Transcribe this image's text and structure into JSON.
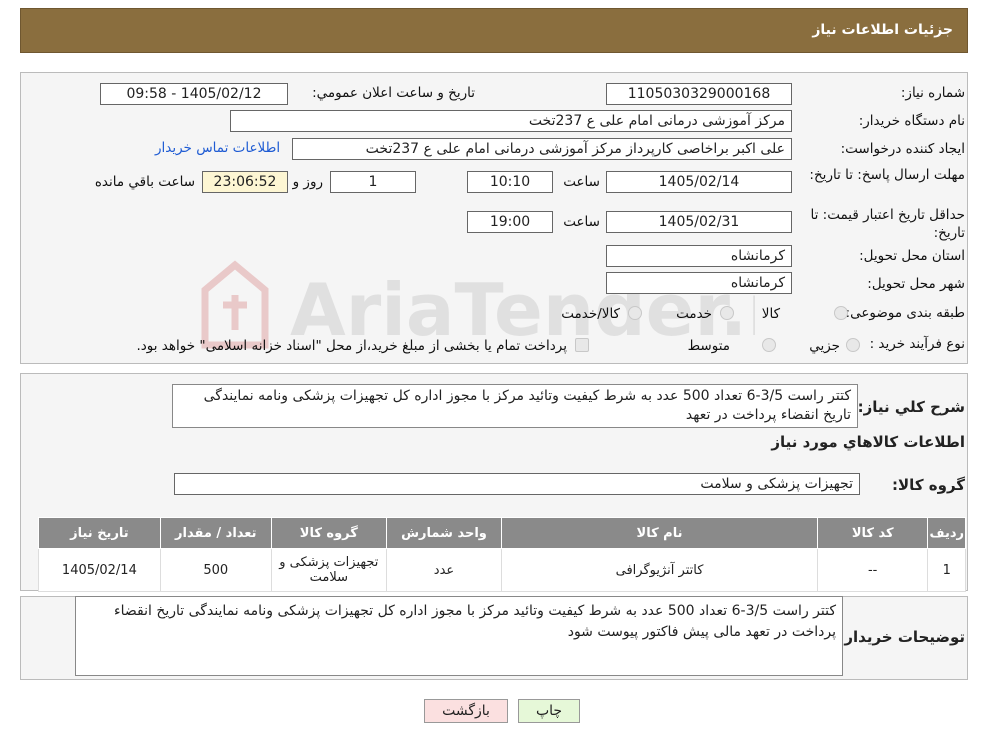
{
  "header": {
    "title": "جزئیات اطلاعات نیاز"
  },
  "watermark": {
    "text": "AriaTender.neT"
  },
  "info": {
    "need_number_label": "شماره نیاز:",
    "need_number": "1105030329000168",
    "announce_label": "تاریخ و ساعت اعلان عمومي:",
    "announce_value": "1405/02/12 - 09:58",
    "buyer_org_label": "نام دستگاه خريدار:",
    "buyer_org": "مرکز آموزشی درمانی امام علی ع 237تخت",
    "creator_label": "ايجاد کننده درخواست:",
    "creator": "علی اکبر براخاصی کارپرداز  مرکز آموزشی درمانی امام علی ع 237تخت",
    "contact_link": "اطلاعات تماس خريدار",
    "reply_deadline_label": "مهلت ارسال پاسخ: تا تاريخ:",
    "reply_date": "1405/02/14",
    "time_label": "ساعت",
    "reply_time": "10:10",
    "days": "1",
    "days_label": "روز و",
    "remaining_time": "23:06:52",
    "remaining_label": "ساعت باقي مانده",
    "price_validity_label": "حداقل تاريخ اعتبار قيمت: تا تاريخ:",
    "price_date": "1405/02/31",
    "price_time": "19:00",
    "province_label": "استان محل تحويل:",
    "province": "کرمانشاه",
    "city_label": "شهر محل تحويل:",
    "city": "کرمانشاه",
    "category_label": "طبقه بندی موضوعی:",
    "category_options": [
      "کالا",
      "خدمت",
      "کالا/خدمت"
    ],
    "purchase_type_label": "نوع فرآيند خريد :",
    "purchase_options": [
      "جزيي",
      "متوسط"
    ],
    "purchase_note": "پرداخت تمام يا بخشی از مبلغ خريد،از محل \"اسناد خزانه اسلامی\" خواهد بود."
  },
  "description": {
    "label": "شرح کلي نياز:",
    "text": "کتتر راست 3/5-6 تعداد 500 عدد به شرط کیفیت وتائید مرکز با مجوز اداره کل تجهیزات پزشکی ونامه نمایندگی تاریخ انقضاء پرداخت در تعهد"
  },
  "goods": {
    "section_title": "اطلاعات کالاهاي مورد نياز",
    "group_label": "گروه کالا:",
    "group_value": "تجهیزات پزشکی و سلامت",
    "columns": [
      "رديف",
      "کد کالا",
      "نام کالا",
      "واحد شمارش",
      "گروه کالا",
      "تعداد / مقدار",
      "تاريخ نياز"
    ],
    "rows": [
      {
        "row": "1",
        "code": "--",
        "name": "کاتتر آنژیوگرافی",
        "unit": "عدد",
        "group": "تجهیزات پزشکی و سلامت",
        "qty": "500",
        "date": "1405/02/14"
      }
    ]
  },
  "buyer_notes": {
    "label": "توضيحات خريدار:",
    "text": "کتتر راست 3/5-6 تعداد 500 عدد به شرط کیفیت وتائید مرکز با مجوز اداره کل تجهیزات پزشکی ونامه نمایندگی تاریخ انقضاء پرداخت در تعهد مالی پیش فاکتور پیوست شود"
  },
  "buttons": {
    "print": "چاپ",
    "back": "بازگشت"
  },
  "colors": {
    "header_bg": "#8a6e3e",
    "table_header_bg": "#8a8a8a",
    "link": "#1e5bd3",
    "print_btn": "#e6f8d8",
    "back_btn": "#fbe0e0"
  }
}
